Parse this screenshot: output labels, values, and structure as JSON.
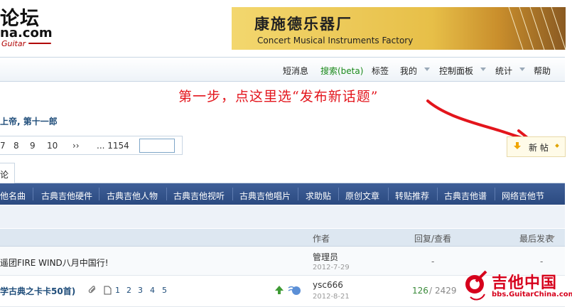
{
  "header": {
    "logo_main": "论坛",
    "logo_domain": "na.com",
    "logo_guitar": "Guitar",
    "banner_cn": "康施德乐器厂",
    "banner_en": "Concert Musical Instruments Factory"
  },
  "nav": {
    "items": [
      "短消息",
      "搜索(beta)",
      "标签",
      "我的",
      "控制面板",
      "统计",
      "帮助"
    ],
    "search_color": "#1b8a1b"
  },
  "annotation": {
    "text": "第一步，点这里选“发布新话题”",
    "color": "#e3151c"
  },
  "moderators": "上帝, 第十一郎",
  "pagination": {
    "pages": [
      "7",
      "8",
      "9",
      "10",
      "››",
      "... 1154"
    ],
    "jump_value": ""
  },
  "new_post": {
    "label": "新 帖"
  },
  "tab": {
    "label": "论"
  },
  "categories": [
    "他名曲",
    "古典吉他硬件",
    "古典吉他人物",
    "古典吉他视听",
    "古典吉他唱片",
    "求助贴",
    "原创文章",
    "转贴推荐",
    "古典吉他谱",
    "网络吉他节"
  ],
  "table": {
    "headers": {
      "author": "作者",
      "replies": "回复/查看",
      "last": "最后发表"
    },
    "rows": [
      {
        "title": "遥团FIRE WIND八月中国行!",
        "author": "管理员",
        "date": "2012-7-29",
        "replies": "-",
        "views": ""
      },
      {
        "title": "学古典之卡卡50首)",
        "pages": [
          "1",
          "2",
          "3",
          "4",
          "5"
        ],
        "author": "ysc666",
        "date": "2012-8-21",
        "replies": "126",
        "views": "2429"
      }
    ]
  },
  "watermark": {
    "title": "吉他中国",
    "url": "bbs.GuitarChina.com"
  },
  "colors": {
    "category_bar": "#2f4f86",
    "accent_blue": "#1f4d7a",
    "watermark_red": "#d6001c"
  }
}
